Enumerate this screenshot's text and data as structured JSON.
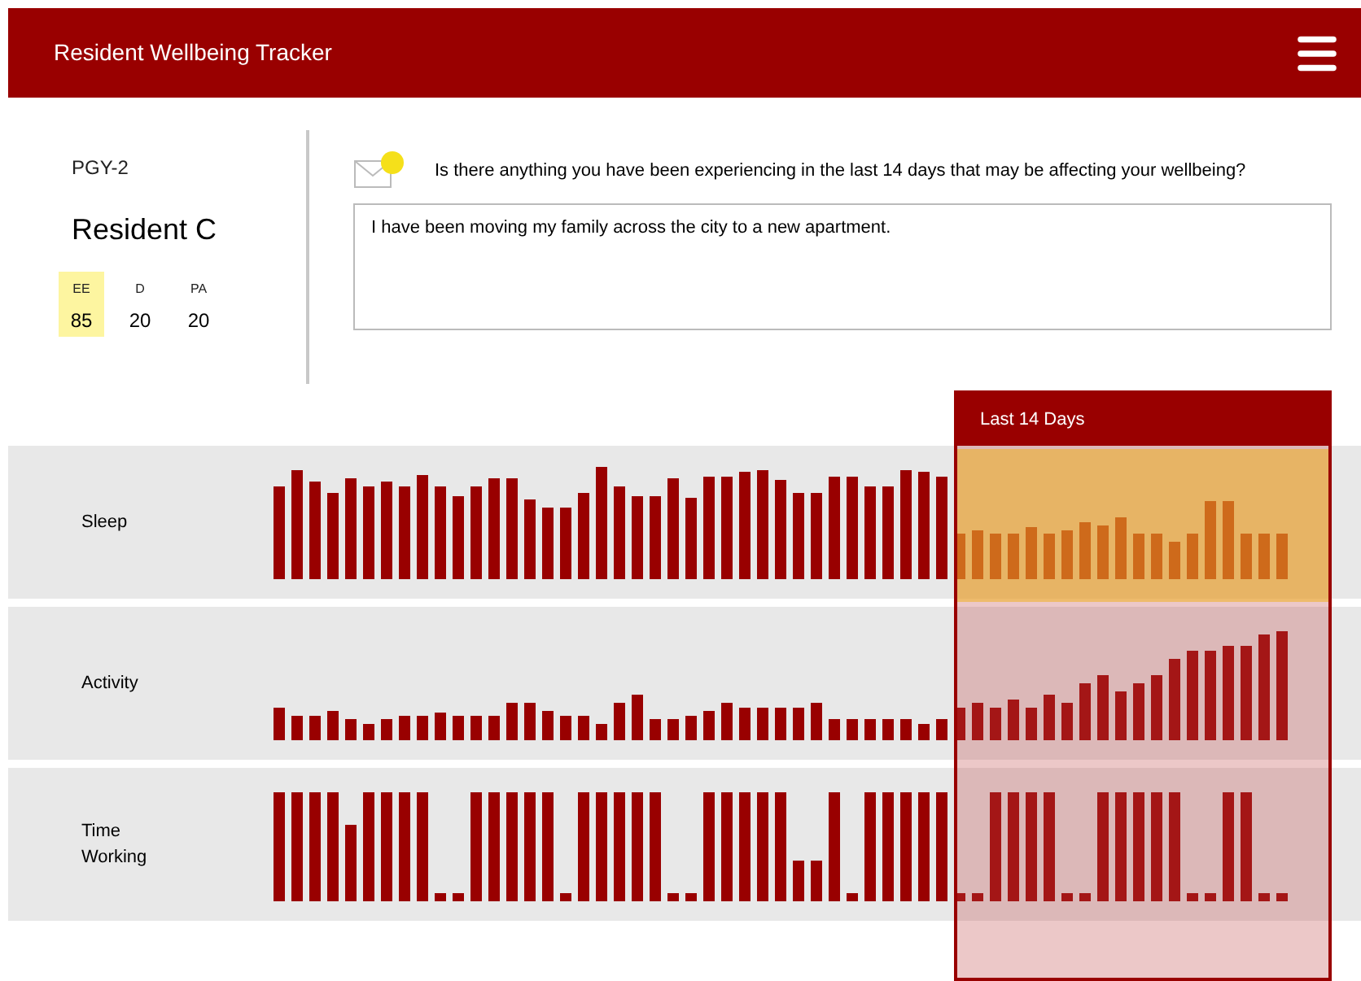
{
  "header": {
    "title": "Resident Wellbeing Tracker"
  },
  "resident": {
    "level": "PGY-2",
    "name": "Resident C"
  },
  "scores": [
    {
      "label": "EE",
      "value": "85",
      "highlighted": true
    },
    {
      "label": "D",
      "value": "20",
      "highlighted": false
    },
    {
      "label": "PA",
      "value": "20",
      "highlighted": false
    }
  ],
  "question": {
    "text": "Is there anything you have been experiencing in the last 14 days that may be affecting your wellbeing?",
    "answer": "I have been moving my family across the city to a new apartment.",
    "unread": true
  },
  "metrics": [
    {
      "label": "Sleep"
    },
    {
      "label": "Activity"
    },
    {
      "label": "Time Working"
    }
  ],
  "highlight": {
    "label": "Last 14 Days"
  }
}
